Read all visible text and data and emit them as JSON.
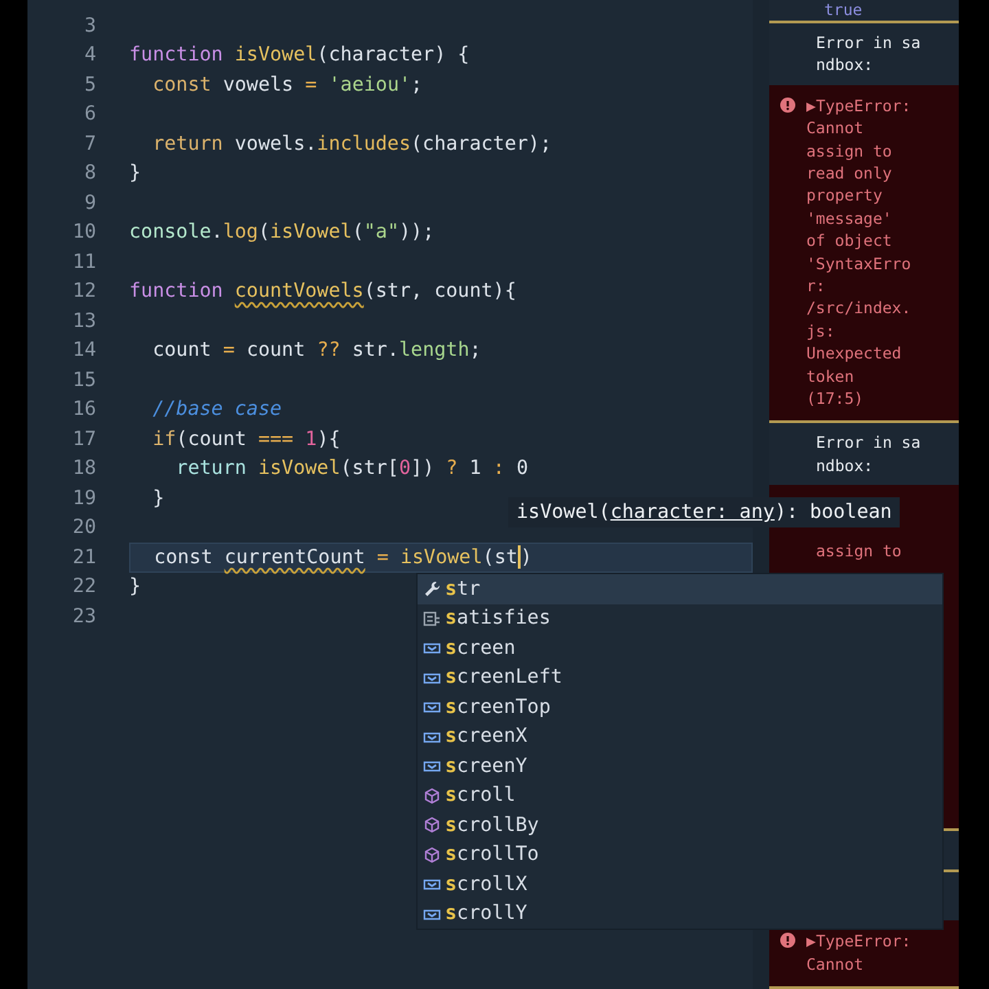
{
  "editor": {
    "lines": [
      {
        "number": "3",
        "current": false
      },
      {
        "number": "4",
        "current": false,
        "tokens": [
          {
            "kind": "kw",
            "text": "function "
          },
          {
            "kind": "fn",
            "text": "isVowel"
          },
          {
            "kind": "punc",
            "text": "(character) {"
          }
        ]
      },
      {
        "number": "5",
        "current": false,
        "tokens": [
          {
            "kind": "ctl",
            "text": "  const "
          },
          {
            "kind": "id",
            "text": "vowels "
          },
          {
            "kind": "op",
            "text": "= "
          },
          {
            "kind": "str",
            "text": "'aeiou'"
          },
          {
            "kind": "punc",
            "text": ";"
          }
        ]
      },
      {
        "number": "6",
        "current": false
      },
      {
        "number": "7",
        "current": false,
        "tokens": [
          {
            "kind": "ctl",
            "text": "  return "
          },
          {
            "kind": "id",
            "text": "vowels."
          },
          {
            "kind": "method",
            "text": "includes"
          },
          {
            "kind": "punc",
            "text": "(character);"
          }
        ]
      },
      {
        "number": "8",
        "current": false,
        "tokens": [
          {
            "kind": "punc",
            "text": "}"
          }
        ]
      },
      {
        "number": "9",
        "current": false
      },
      {
        "number": "10",
        "current": false,
        "tokens": [
          {
            "kind": "obj",
            "text": "console"
          },
          {
            "kind": "punc",
            "text": "."
          },
          {
            "kind": "method",
            "text": "log"
          },
          {
            "kind": "punc",
            "text": "("
          },
          {
            "kind": "fn",
            "text": "isVowel"
          },
          {
            "kind": "punc",
            "text": "("
          },
          {
            "kind": "str",
            "text": "\"a\""
          },
          {
            "kind": "punc",
            "text": "));"
          }
        ]
      },
      {
        "number": "11",
        "current": false
      },
      {
        "number": "12",
        "current": false,
        "tokens": [
          {
            "kind": "kw",
            "text": "function "
          },
          {
            "kind": "fn",
            "text": "countVowels",
            "warning": true
          },
          {
            "kind": "punc",
            "text": "(str, count){"
          }
        ]
      },
      {
        "number": "13",
        "current": false
      },
      {
        "number": "14",
        "current": false,
        "tokens": [
          {
            "kind": "id",
            "text": "  count "
          },
          {
            "kind": "op",
            "text": "= "
          },
          {
            "kind": "id",
            "text": "count "
          },
          {
            "kind": "op",
            "text": "?? "
          },
          {
            "kind": "id",
            "text": "str."
          },
          {
            "kind": "prop",
            "text": "length"
          },
          {
            "kind": "punc",
            "text": ";"
          }
        ]
      },
      {
        "number": "15",
        "current": false
      },
      {
        "number": "16",
        "current": false,
        "tokens": [
          {
            "kind": "comment",
            "text": "  //base case"
          }
        ]
      },
      {
        "number": "17",
        "current": false,
        "tokens": [
          {
            "kind": "ctl",
            "text": "  if"
          },
          {
            "kind": "punc",
            "text": "(count "
          },
          {
            "kind": "op",
            "text": "=== "
          },
          {
            "kind": "num",
            "text": "1"
          },
          {
            "kind": "punc",
            "text": "){"
          }
        ]
      },
      {
        "number": "18",
        "current": false,
        "tokens": [
          {
            "kind": "ret",
            "text": "    return "
          },
          {
            "kind": "fn",
            "text": "isVowel"
          },
          {
            "kind": "punc",
            "text": "(str["
          },
          {
            "kind": "num",
            "text": "0"
          },
          {
            "kind": "punc",
            "text": "]) "
          },
          {
            "kind": "op",
            "text": "? "
          },
          {
            "kind": "id",
            "text": "1 "
          },
          {
            "kind": "op",
            "text": ": "
          },
          {
            "kind": "id",
            "text": "0"
          }
        ]
      },
      {
        "number": "19",
        "current": false,
        "tokens": [
          {
            "kind": "punc",
            "text": "  }"
          }
        ]
      },
      {
        "number": "20",
        "current": false
      },
      {
        "number": "21",
        "current": true,
        "tokens": [
          {
            "kind": "id",
            "text": "  const "
          },
          {
            "kind": "id",
            "text": "currentCount",
            "warning": true
          },
          {
            "kind": "op",
            "text": " = "
          },
          {
            "kind": "fn",
            "text": "isVowel"
          },
          {
            "kind": "punc",
            "text": "("
          },
          {
            "kind": "id",
            "text": "st",
            "cursor": true
          },
          {
            "kind": "punc",
            "text": ")"
          }
        ]
      },
      {
        "number": "22",
        "current": false,
        "tokens": [
          {
            "kind": "punc",
            "text": "}"
          }
        ]
      },
      {
        "number": "23",
        "current": false
      }
    ]
  },
  "hover": {
    "name": "isVowel(",
    "param": "character: any",
    "rest": "): boolean"
  },
  "suggestions": [
    {
      "kind": "parameter",
      "match": "s",
      "rest": "tr",
      "selected": true
    },
    {
      "kind": "keyword",
      "match": "s",
      "rest": "atisfies",
      "selected": false
    },
    {
      "kind": "field",
      "match": "s",
      "rest": "creen",
      "selected": false
    },
    {
      "kind": "field",
      "match": "s",
      "rest": "creenLeft",
      "selected": false
    },
    {
      "kind": "field",
      "match": "s",
      "rest": "creenTop",
      "selected": false
    },
    {
      "kind": "field",
      "match": "s",
      "rest": "creenX",
      "selected": false
    },
    {
      "kind": "field",
      "match": "s",
      "rest": "creenY",
      "selected": false
    },
    {
      "kind": "method",
      "match": "s",
      "rest": "croll",
      "selected": false
    },
    {
      "kind": "method",
      "match": "s",
      "rest": "crollBy",
      "selected": false
    },
    {
      "kind": "method",
      "match": "s",
      "rest": "crollTo",
      "selected": false
    },
    {
      "kind": "field",
      "match": "s",
      "rest": "crollX",
      "selected": false
    },
    {
      "kind": "field",
      "match": "s",
      "rest": "crollY",
      "selected": false
    }
  ],
  "console": {
    "entries": [
      {
        "kind": "log",
        "text": "true"
      },
      {
        "kind": "header",
        "text": "Error in sandbox:"
      },
      {
        "kind": "error",
        "toggle": "▶",
        "text": "TypeError: Cannot assign to read only property 'message' of object 'SyntaxError: /src/index.js: Unexpected token (17:5)"
      },
      {
        "kind": "header",
        "text": "Error in sandbox:"
      },
      {
        "kind": "partial",
        "text": "assign to"
      },
      {
        "kind": "blank"
      },
      {
        "kind": "error",
        "toggle": "▶",
        "text": "TypeError: Cannot"
      }
    ]
  }
}
